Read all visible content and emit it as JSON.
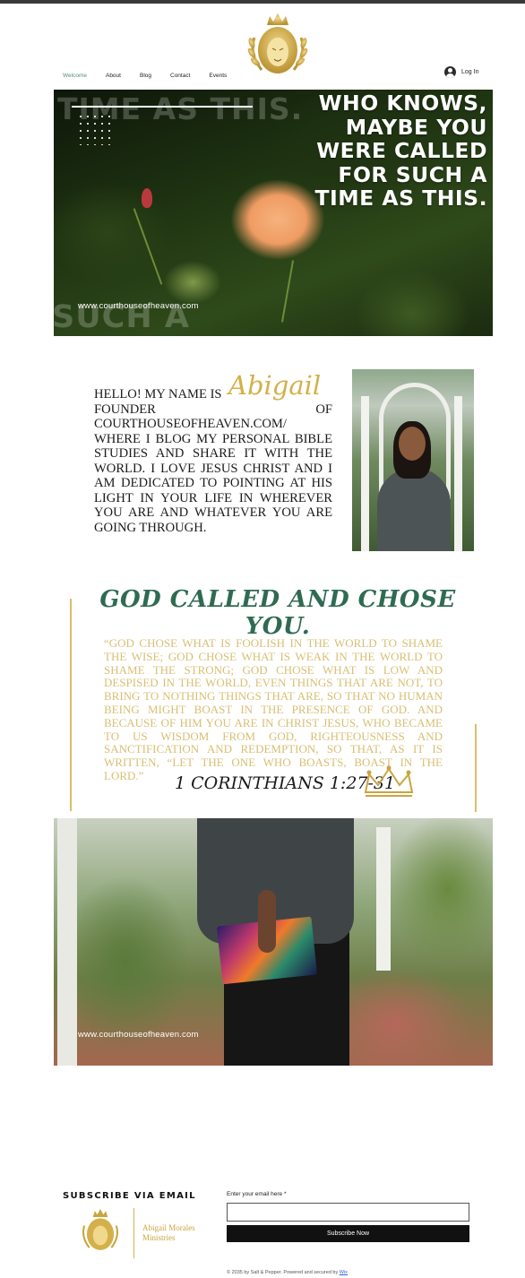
{
  "header": {
    "nav": [
      {
        "label": "Welcome",
        "active": true
      },
      {
        "label": "About",
        "active": false
      },
      {
        "label": "Blog",
        "active": false
      },
      {
        "label": "Contact",
        "active": false
      },
      {
        "label": "Events",
        "active": false
      }
    ],
    "login_label": "Log In",
    "logo_icon": "lion-crown-laurel-logo"
  },
  "hero": {
    "ghost_top": "TIME AS THIS.",
    "ghost_bottom": "SUCH A",
    "quote_lines": [
      "WHO KNOWS,",
      "MAYBE YOU",
      "WERE CALLED",
      "FOR SUCH A",
      "TIME AS THIS."
    ],
    "url": "www.courthouseofheaven.com"
  },
  "bio": {
    "intro": "HELLO! MY NAME IS",
    "signature": "Abigail",
    "text": "FOUNDER OF COURTHOUSEOFHEAVEN.COM/ WHERE I BLOG MY PERSONAL BIBLE STUDIES AND SHARE IT WITH THE WORLD. I LOVE JESUS CHRIST AND I AM DEDICATED TO POINTING AT HIS LIGHT IN YOUR LIFE IN WHEREVER YOU ARE AND WHATEVER YOU ARE GOING THROUGH."
  },
  "verse": {
    "title": "GOD CALLED AND CHOSE YOU.",
    "body": "“GOD CHOSE WHAT IS FOOLISH IN THE WORLD TO SHAME THE WISE; GOD CHOSE WHAT IS WEAK IN THE WORLD TO SHAME THE STRONG; GOD CHOSE WHAT IS LOW AND DESPISED IN THE WORLD, EVEN THINGS THAT ARE NOT, TO BRING TO NOTHING THINGS THAT ARE, SO THAT NO HUMAN BEING MIGHT BOAST IN THE PRESENCE OF GOD. AND BECAUSE OF HIM YOU ARE IN CHRIST JESUS, WHO BECAME TO US WISDOM FROM GOD, RIGHTEOUSNESS AND SANCTIFICATION AND REDEMPTION, SO THAT, AS IT IS WRITTEN, “LET THE ONE WHO BOASTS, BOAST IN THE LORD.”",
    "reference": "1 CORINTHIANS 1:27-31",
    "icon": "crown-icon"
  },
  "photo2": {
    "url": "www.courthouseofheaven.com"
  },
  "footer": {
    "subscribe_title": "SUBSCRIBE VIA EMAIL",
    "brand_line1": "Abigail Morales",
    "brand_line2": "Ministries",
    "email_label": "Enter your email here *",
    "email_value": "",
    "subscribe_button": "Subscribe Now",
    "copyright": "© 2035 by Salt & Pepper. Powered and secured by",
    "copyright_link": "Wix"
  },
  "colors": {
    "accent_gold": "#d4b04a",
    "verse_green": "#2f6b52",
    "verse_text": "#d8bf74",
    "nav_active": "#5a8a78"
  }
}
